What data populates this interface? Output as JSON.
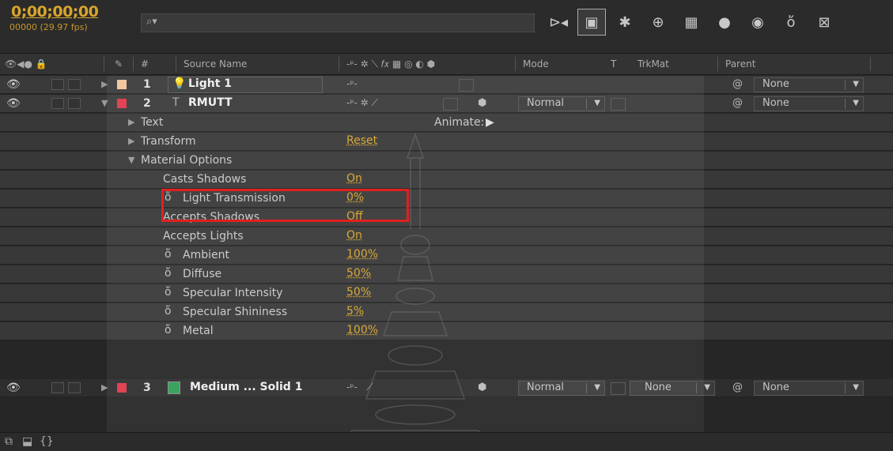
{
  "timecode": "0;00;00;00",
  "frames": "00000 (29.97 fps)",
  "search": {
    "value": "",
    "placeholder": ""
  },
  "columns": {
    "hash": "#",
    "source_name": "Source Name",
    "mode": "Mode",
    "t": "T",
    "trkmat": "TrkMat",
    "parent": "Parent"
  },
  "layers": [
    {
      "num": "1",
      "name": "Light 1",
      "color": "#f2c49a",
      "parent": "None"
    },
    {
      "num": "2",
      "name": "RMUTT",
      "color": "#e0394a",
      "mode": "Normal",
      "parent": "None"
    },
    {
      "num": "3",
      "name": "Medium ... Solid 1",
      "color": "#e0394a",
      "solid_color": "#2e9e57",
      "mode": "Normal",
      "trkmat": "None",
      "parent": "None"
    }
  ],
  "props": {
    "text": "Text",
    "animate": "Animate:",
    "transform": "Transform",
    "transform_val": "Reset",
    "material": "Material Options",
    "casts_shadows": "Casts Shadows",
    "casts_shadows_val": "On",
    "light_transmission": "Light Transmission",
    "light_transmission_val": "0%",
    "accepts_shadows": "Accepts Shadows",
    "accepts_shadows_val": "Off",
    "accepts_lights": "Accepts Lights",
    "accepts_lights_val": "On",
    "ambient": "Ambient",
    "ambient_val": "100%",
    "diffuse": "Diffuse",
    "diffuse_val": "50%",
    "specular_intensity": "Specular Intensity",
    "specular_intensity_val": "50%",
    "specular_shininess": "Specular Shininess",
    "specular_shininess_val": "5%",
    "metal": "Metal",
    "metal_val": "100%"
  },
  "colors": {
    "accent": "#d8a52c",
    "highlight": "#e02020"
  }
}
